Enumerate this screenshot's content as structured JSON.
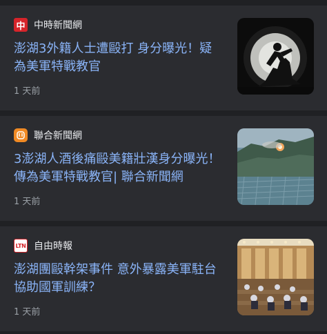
{
  "articles": [
    {
      "source": "中時新聞網",
      "source_logo": "中",
      "headline": "澎湖3外籍人士遭毆打 身分曝光！疑為美軍特戰教官",
      "time": "1 天前",
      "thumbnail_icon": "tunnel-fight-image"
    },
    {
      "source": "聯合新聞網",
      "source_logo": "",
      "headline": "3澎湖人酒後痛毆美籍壯漢身分曝光！傳為美軍特戰教官| 聯合新聞網",
      "time": "1 天前",
      "thumbnail_icon": "military-hillside-image"
    },
    {
      "source": "自由時報",
      "source_logo": "LTN",
      "headline": "澎湖團毆幹架事件 意外暴露美軍駐台協助國軍訓練？",
      "time": "1 天前",
      "thumbnail_icon": "legislature-hall-image"
    }
  ],
  "colors": {
    "background": "#202124",
    "card": "#2b2c30",
    "headline": "#8ab4f8",
    "source_text": "#e8eaed",
    "time_text": "#9aa0a6"
  }
}
